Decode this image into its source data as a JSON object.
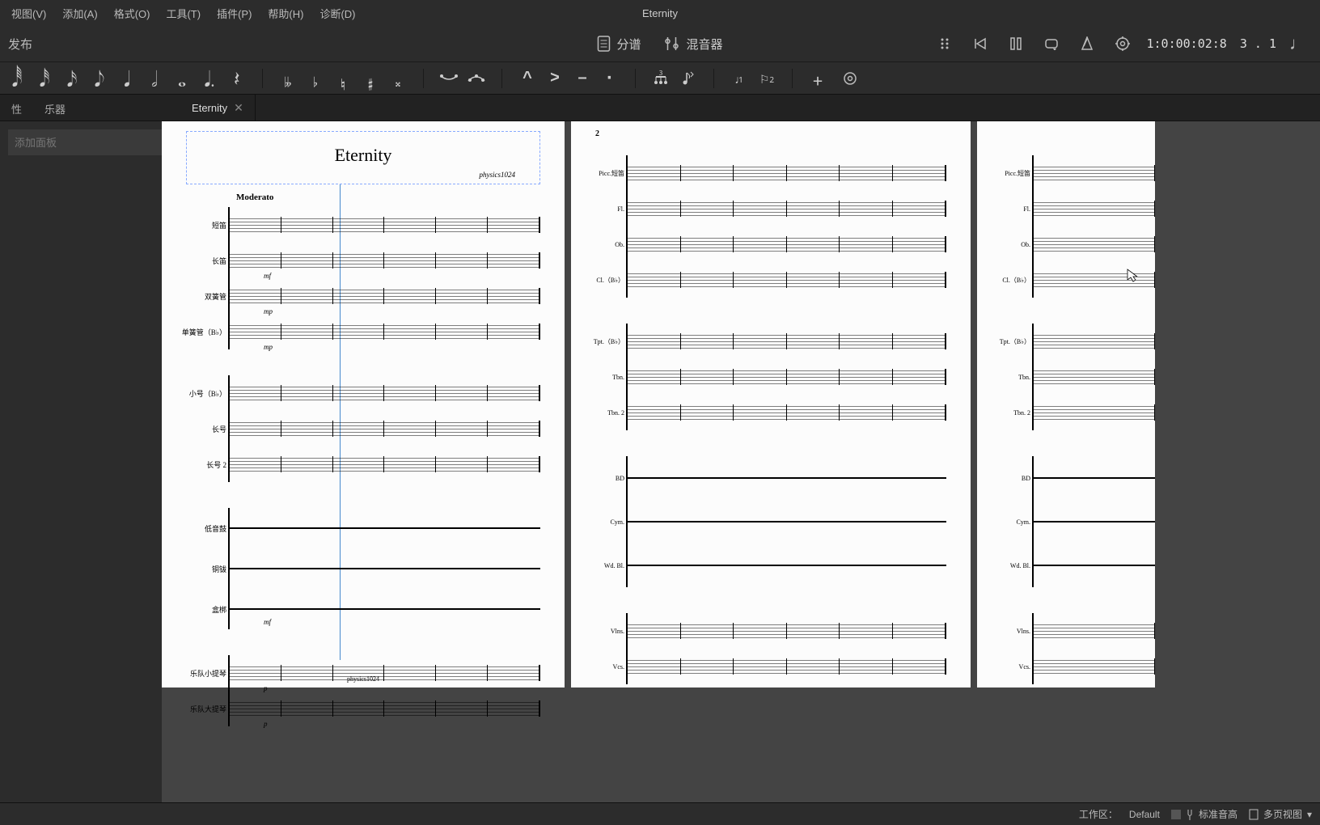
{
  "menubar": {
    "items": [
      {
        "label": "视图(V)"
      },
      {
        "label": "添加(A)"
      },
      {
        "label": "格式(O)"
      },
      {
        "label": "工具(T)"
      },
      {
        "label": "插件(P)"
      },
      {
        "label": "帮助(H)"
      },
      {
        "label": "诊断(D)"
      }
    ],
    "document_title": "Eternity"
  },
  "topbar": {
    "publish_label": "发布",
    "parts_label": "分谱",
    "mixer_label": "混音器",
    "timecode": "1:0:00:02:8",
    "position": "3 . 1"
  },
  "note_toolbar": {
    "notes": [
      "𝅘𝅥𝅱",
      "𝅘𝅥𝅰",
      "𝅘𝅥𝅯",
      "𝅘𝅥𝅮",
      "𝅘𝅥",
      "𝅗𝅥",
      "𝅝"
    ],
    "dot": "𝅘𝅥.",
    "rest": "𝄽",
    "accidentals": [
      "𝄫",
      "♭",
      "♮",
      "♯",
      "𝄪"
    ],
    "ties": [
      "tie",
      "slur"
    ],
    "articulations": [
      "^",
      ">",
      "–",
      "·"
    ],
    "tuplet_btn": "tuplet",
    "flip_btn": "flip",
    "voice1": "♩1",
    "voice2": "2",
    "add": "+",
    "settings": "⚙"
  },
  "side_tabs": {
    "tab1": "性",
    "tab2": "乐器"
  },
  "doc_tab": {
    "label": "Eternity"
  },
  "sidebar": {
    "search_placeholder": "添加面板"
  },
  "score": {
    "title": "Eternity",
    "composer": "physics1024",
    "tempo": "Moderato",
    "footer": "physics1024",
    "page2_number": "2",
    "instruments_page1": [
      {
        "label": "短笛"
      },
      {
        "label": "长笛",
        "dyn": "mf"
      },
      {
        "label": "双簧管",
        "dyn": "mp"
      },
      {
        "label": "单簧管（B♭）",
        "dyn": "mp"
      }
    ],
    "brass_page1": [
      {
        "label": "小号（B♭）"
      },
      {
        "label": "长号"
      },
      {
        "label": "长号 2"
      }
    ],
    "perc_page1": [
      {
        "label": "低音鼓"
      },
      {
        "label": "铜钹"
      },
      {
        "label": "盒梆",
        "dyn": "mf"
      }
    ],
    "strings_page1": [
      {
        "label": "乐队小提琴",
        "dyn": "p"
      },
      {
        "label": "乐队大提琴",
        "dyn": "p"
      }
    ],
    "instruments_page2": [
      {
        "label": "Picc.短笛"
      },
      {
        "label": "Fl."
      },
      {
        "label": "Ob."
      },
      {
        "label": "Cl.（B♭）"
      }
    ],
    "brass_page2": [
      {
        "label": "Tpt.（B♭）"
      },
      {
        "label": "Tbn."
      },
      {
        "label": "Tbn. 2"
      }
    ],
    "perc_page2": [
      {
        "label": "BD"
      },
      {
        "label": "Cym."
      },
      {
        "label": "Wd. Bl."
      }
    ],
    "strings_page2": [
      {
        "label": "Vlns."
      },
      {
        "label": "Vcs."
      }
    ]
  },
  "statusbar": {
    "workspace_label": "工作区：",
    "workspace_value": "Default",
    "concert_pitch_label": "标准音高",
    "multipage_label": "多页视图"
  }
}
